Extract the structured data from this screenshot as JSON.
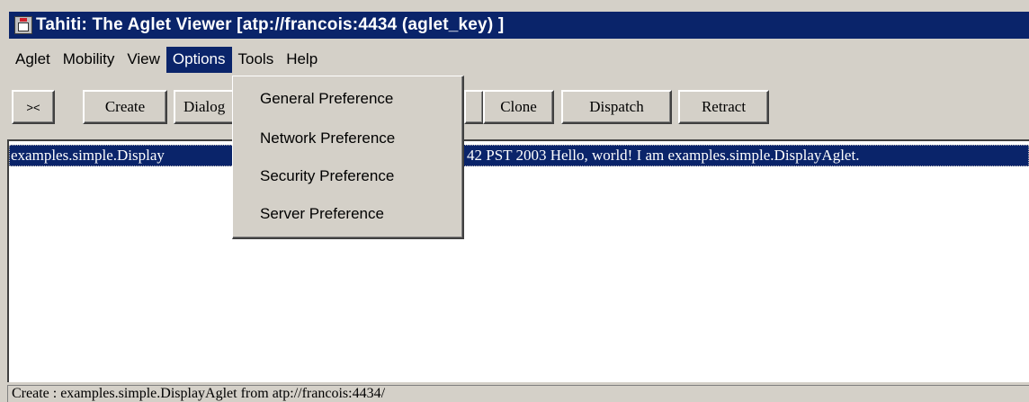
{
  "window": {
    "title": "Tahiti: The Aglet Viewer [atp://francois:4434 (aglet_key) ]",
    "icon": "java-cup-icon"
  },
  "menubar": {
    "items": [
      "Aglet",
      "Mobility",
      "View",
      "Options",
      "Tools",
      "Help"
    ],
    "active": "Options"
  },
  "toolbar": {
    "buttons": [
      {
        "label": "><"
      },
      {
        "label": "Create"
      },
      {
        "label": "Dialog"
      },
      {
        "label": ""
      },
      {
        "label": "Clone"
      },
      {
        "label": "Dispatch"
      },
      {
        "label": "Retract"
      }
    ]
  },
  "options_menu": {
    "items": [
      "General Preference",
      "Network Preference",
      "Security Preference",
      "Server Preference"
    ]
  },
  "aglet_list": {
    "rows": [
      {
        "left_text": "examples.simple.Display",
        "right_text": "42 PST 2003 Hello, world! I am examples.simple.DisplayAglet."
      }
    ]
  },
  "status_bar": {
    "text": "Create : examples.simple.DisplayAglet from atp://francois:4434/"
  },
  "colors": {
    "titlebar": "#0a246a",
    "selection": "#0a246a",
    "face": "#d4d0c8"
  }
}
